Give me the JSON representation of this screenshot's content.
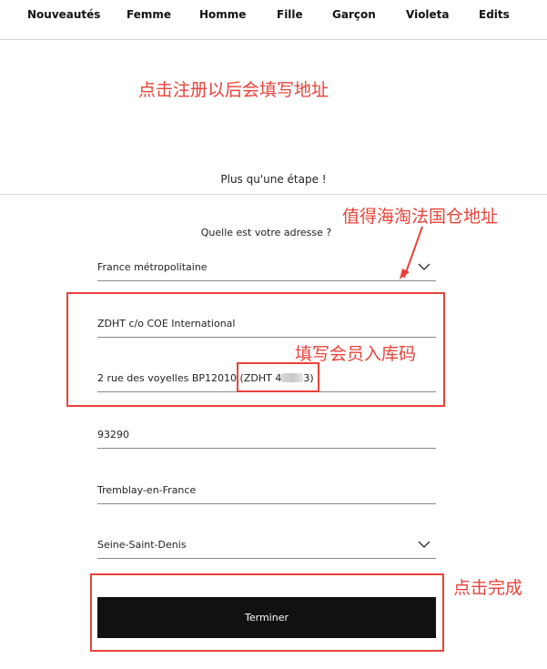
{
  "nav": {
    "items": [
      {
        "label": "Nouveautés"
      },
      {
        "label": "Femme"
      },
      {
        "label": "Homme"
      },
      {
        "label": "Fille"
      },
      {
        "label": "Garçon"
      },
      {
        "label": "Violeta"
      },
      {
        "label": "Edits"
      }
    ]
  },
  "annotations": {
    "top_note": "点击注册以后会填写地址",
    "address_note": "值得海淘法国仓地址",
    "member_code_note": "填写会员入库码",
    "finish_note": "点击完成"
  },
  "form": {
    "step_text": "Plus qu'une étape !",
    "question": "Quelle est votre adresse ?",
    "country": "France métropolitaine",
    "address_line1": "ZDHT c/o COE International",
    "address_line2": "2 rue des voyelles BP12010",
    "member_code_prefix": "(ZDHT 4",
    "member_code_suffix": "3)",
    "postal_code": "93290",
    "city": "Tremblay-en-France",
    "region": "Seine-Saint-Denis",
    "submit_label": "Terminer"
  },
  "colors": {
    "annotation": "#e8433a",
    "button_bg": "#111111",
    "button_text": "#ffffff"
  }
}
